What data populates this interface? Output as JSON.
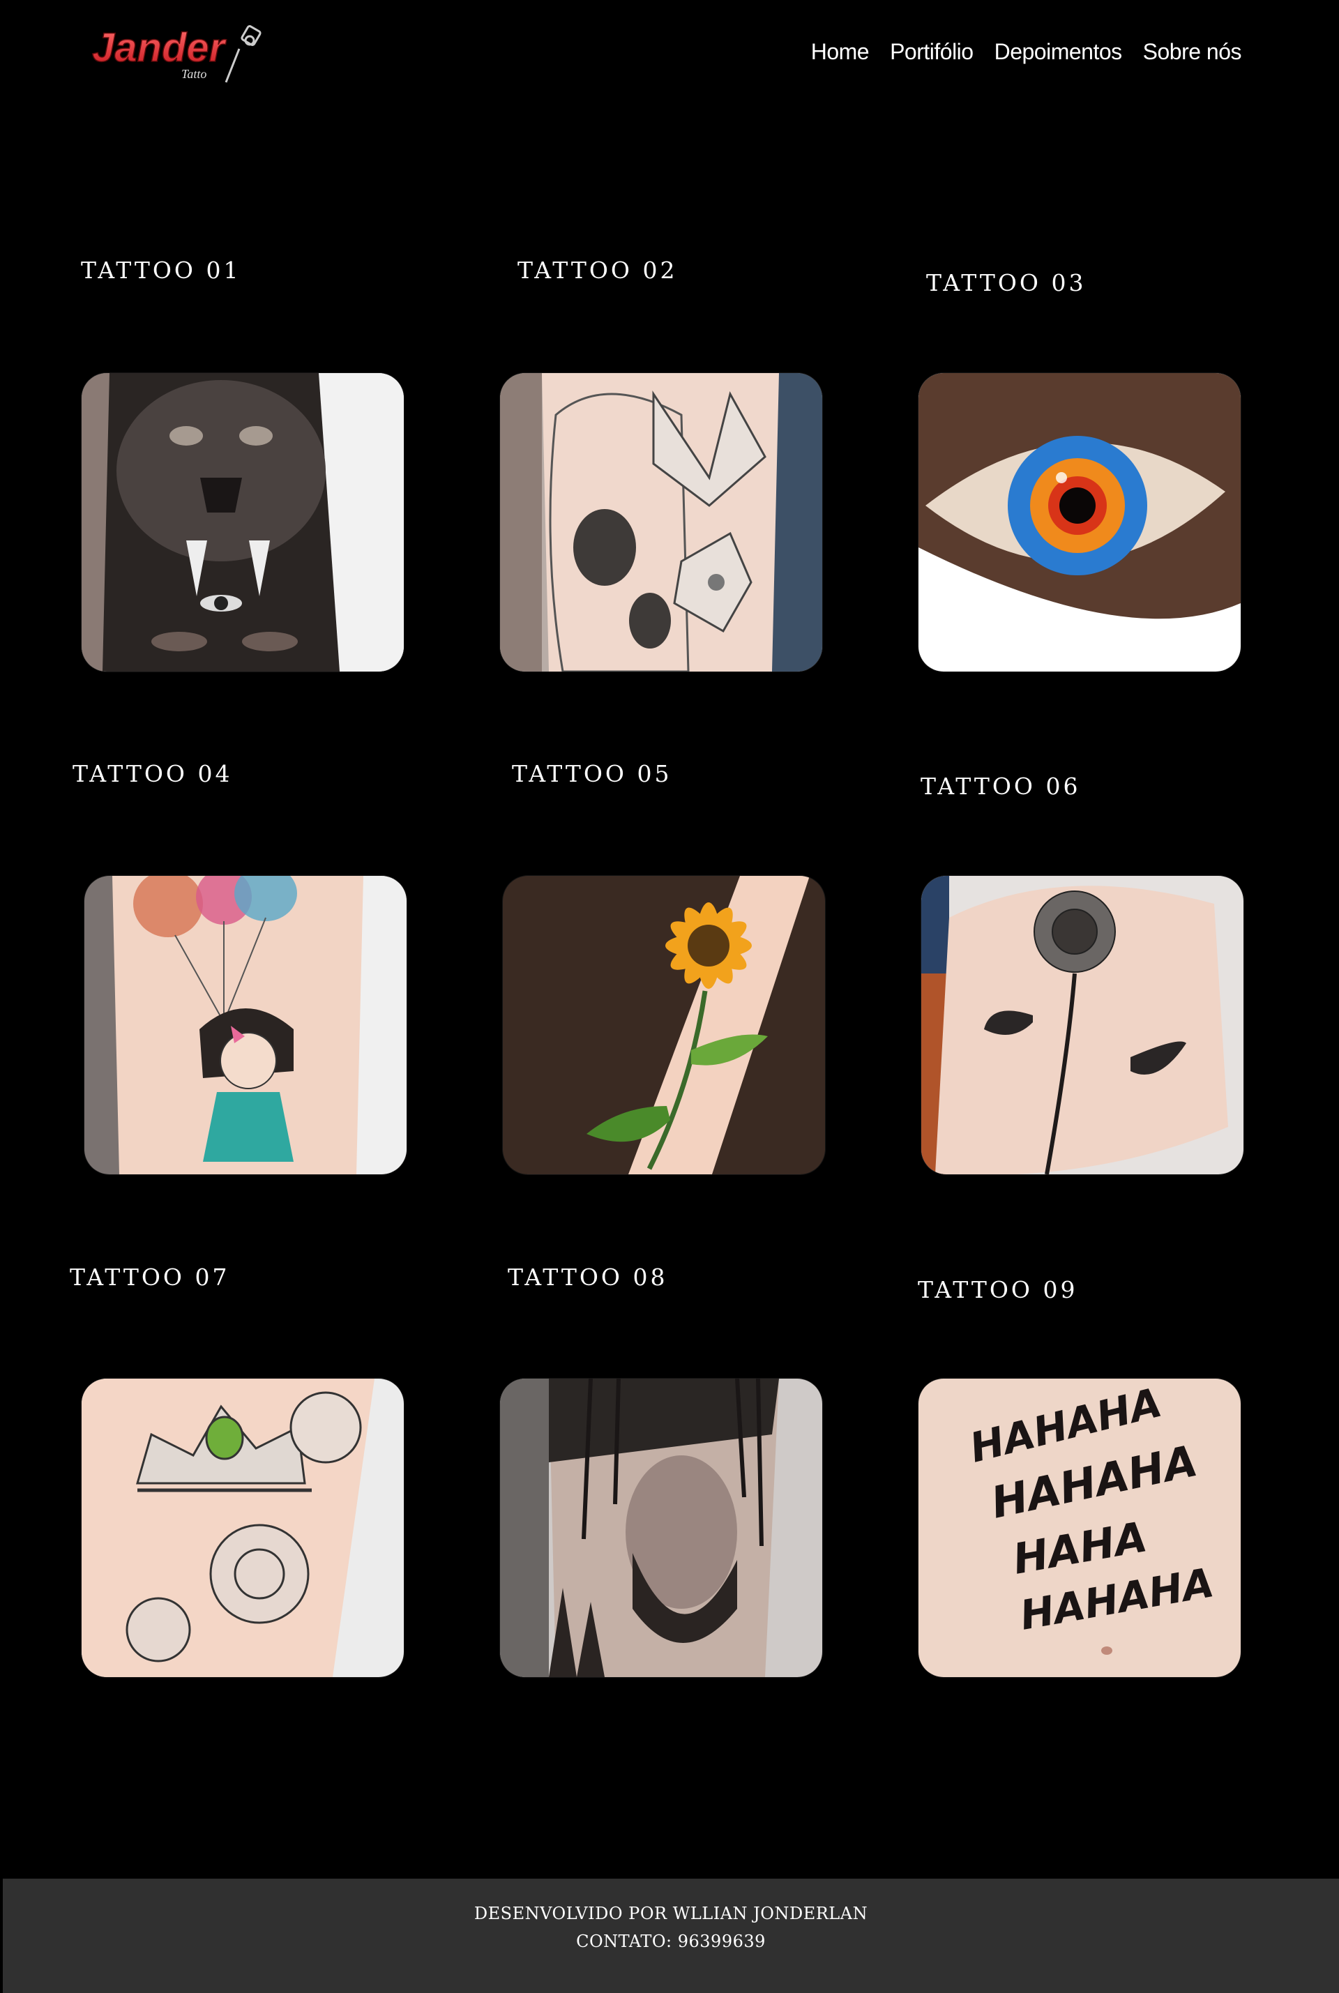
{
  "header": {
    "logo_text": "Jander",
    "logo_subtext": "Tatto",
    "nav": [
      {
        "label": "Home"
      },
      {
        "label": "Portifólio"
      },
      {
        "label": "Depoimentos"
      },
      {
        "label": "Sobre nós"
      }
    ]
  },
  "gallery": [
    {
      "title": "TATTOO 01",
      "image": "lion-face-tattoo"
    },
    {
      "title": "TATTOO 02",
      "image": "skull-lily-tattoo"
    },
    {
      "title": "TATTOO 03",
      "image": "clock-eye-tattoo"
    },
    {
      "title": "TATTOO 04",
      "image": "girl-balloons-tattoo"
    },
    {
      "title": "TATTOO 05",
      "image": "sunflower-tattoo"
    },
    {
      "title": "TATTOO 06",
      "image": "rose-tattoo"
    },
    {
      "title": "TATTOO 07",
      "image": "crown-roses-tattoo"
    },
    {
      "title": "TATTOO 08",
      "image": "bearded-man-forest-tattoo"
    },
    {
      "title": "TATTOO 09",
      "image": "hahaha-chest-tattoo"
    }
  ],
  "footer": {
    "developed_by": "DESENVOLVIDO POR WLLIAN JONDERLAN",
    "contact": "CONTATO: 96399639"
  },
  "colors": {
    "background": "#000000",
    "footer_bg": "#303030",
    "text": "#ffffff",
    "logo_red": "#e8333a"
  }
}
